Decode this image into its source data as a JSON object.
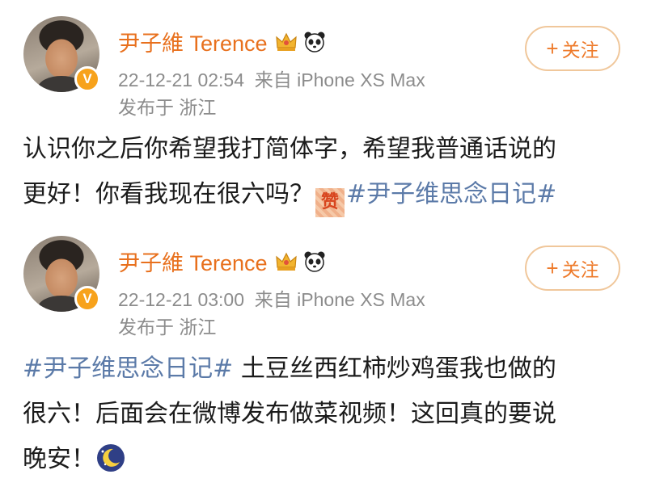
{
  "posts": [
    {
      "user_name": "尹子維 Terence",
      "timestamp": "22-12-21 02:54",
      "source": "来自 iPhone XS Max",
      "location": "发布于 浙江",
      "follow_label": "关注",
      "lines": [
        {
          "text": "认识你之后你希望我打简体字，希望我普通话说的"
        },
        {
          "before": "更好！你看我现在很六吗？",
          "emoji": "赞",
          "hashtag": "#尹子维思念日记#"
        }
      ]
    },
    {
      "user_name": "尹子維 Terence",
      "timestamp": "22-12-21 03:00",
      "source": "来自 iPhone XS Max",
      "location": "发布于 浙江",
      "follow_label": "关注",
      "lines": [
        {
          "hashtag": "#尹子维思念日记#",
          "after": " 土豆丝西红柿炒鸡蛋我也做的"
        },
        {
          "text": "很六！后面会在微博发布做菜视频！这回真的要说"
        },
        {
          "text": "晚安！",
          "emoji": "moon"
        }
      ]
    }
  ],
  "icons": {
    "verified_badge": "v-badge-icon",
    "crown": "crown-icon",
    "panda": "panda-icon",
    "zan": "zan-emoji",
    "moon": "moon-emoji"
  },
  "colors": {
    "username": "#e8701d",
    "meta": "#8c8c8c",
    "hashtag": "#5b7aa8",
    "follow_border": "#f0c79b",
    "follow_text": "#ee7a2a",
    "badge": "#f7a21b"
  }
}
